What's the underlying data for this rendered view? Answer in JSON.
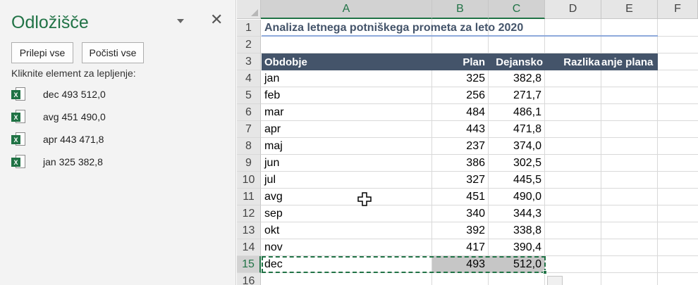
{
  "pane": {
    "title": "Odložišče",
    "close_glyph": "✕",
    "paste_all": "Prilepi vse",
    "clear_all": "Počisti vse",
    "instruction": "Kliknite element za lepljenje:",
    "items": [
      {
        "icon": "excel-icon",
        "text": "dec 493 512,0"
      },
      {
        "icon": "excel-icon",
        "text": "avg 451 490,0"
      },
      {
        "icon": "excel-icon",
        "text": "apr 443 471,8"
      },
      {
        "icon": "excel-icon",
        "text": "jan 325 382,8"
      }
    ]
  },
  "sheet": {
    "columns": [
      "A",
      "B",
      "C",
      "D",
      "E",
      "F"
    ],
    "rows": [
      "1",
      "2",
      "3",
      "4",
      "5",
      "6",
      "7",
      "8",
      "9",
      "10",
      "11",
      "12",
      "13",
      "14",
      "15",
      "16"
    ],
    "title": "Analiza letnega potniškega prometa za leto 2020",
    "headers": {
      "a": "Obdobje",
      "b": "Plan",
      "c": "Dejansko",
      "d": "Razlika",
      "e": "anje plana"
    },
    "data": [
      {
        "month": "jan",
        "plan": "325",
        "actual": "382,8"
      },
      {
        "month": "feb",
        "plan": "256",
        "actual": "271,7"
      },
      {
        "month": "mar",
        "plan": "484",
        "actual": "486,1"
      },
      {
        "month": "apr",
        "plan": "443",
        "actual": "471,8"
      },
      {
        "month": "maj",
        "plan": "237",
        "actual": "374,0"
      },
      {
        "month": "jun",
        "plan": "386",
        "actual": "302,5"
      },
      {
        "month": "jul",
        "plan": "327",
        "actual": "445,5"
      },
      {
        "month": "avg",
        "plan": "451",
        "actual": "490,0"
      },
      {
        "month": "sep",
        "plan": "340",
        "actual": "344,3"
      },
      {
        "month": "okt",
        "plan": "392",
        "actual": "338,8"
      },
      {
        "month": "nov",
        "plan": "417",
        "actual": "390,4"
      },
      {
        "month": "dec",
        "plan": "493",
        "actual": "512,0"
      }
    ]
  },
  "colors": {
    "accent": "#217346",
    "header_band": "#44546a",
    "title_text": "#44546a"
  }
}
